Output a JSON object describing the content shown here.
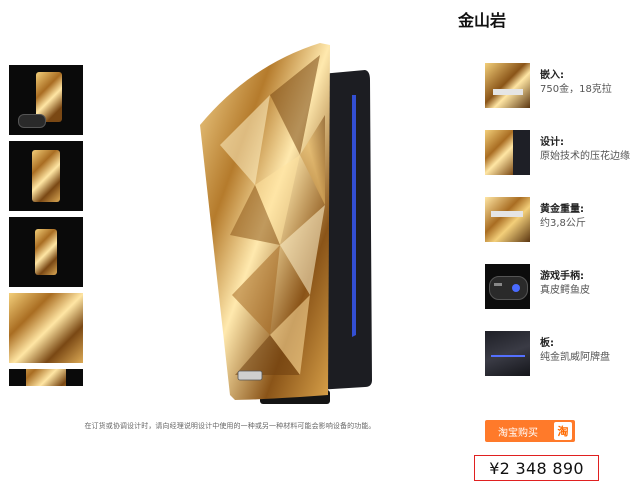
{
  "product": {
    "title": "金山岩",
    "notice": "在订货或协调设计时，请向经理说明设计中使用的一种或另一种材料可能会影响设备的功能。",
    "price": "¥2 348 890",
    "buy_label": "淘宝购买",
    "buy_badge": "淘"
  },
  "thumbnails": [
    {
      "name": "thumb-console-with-controller",
      "icon": "console-icon"
    },
    {
      "name": "thumb-gold-front",
      "icon": "gold-panel-icon"
    },
    {
      "name": "thumb-gold-angle",
      "icon": "gold-panel-icon"
    },
    {
      "name": "thumb-gold-closeup",
      "icon": "gold-texture-icon"
    },
    {
      "name": "thumb-partial",
      "icon": "gold-panel-icon"
    }
  ],
  "features": [
    {
      "label": "嵌入:",
      "value": "750金，18克拉"
    },
    {
      "label": "设计:",
      "value": "原始技术的压花边缘"
    },
    {
      "label": "黄金重量:",
      "value": "约3,8公斤"
    },
    {
      "label": "游戏手柄:",
      "value": "真皮鳄鱼皮"
    },
    {
      "label": "板:",
      "value": "纯金凯威阿牌盘"
    }
  ],
  "colors": {
    "accent": "#ff7a2a",
    "price_border": "#e02020",
    "gold": "#d9a24a"
  }
}
